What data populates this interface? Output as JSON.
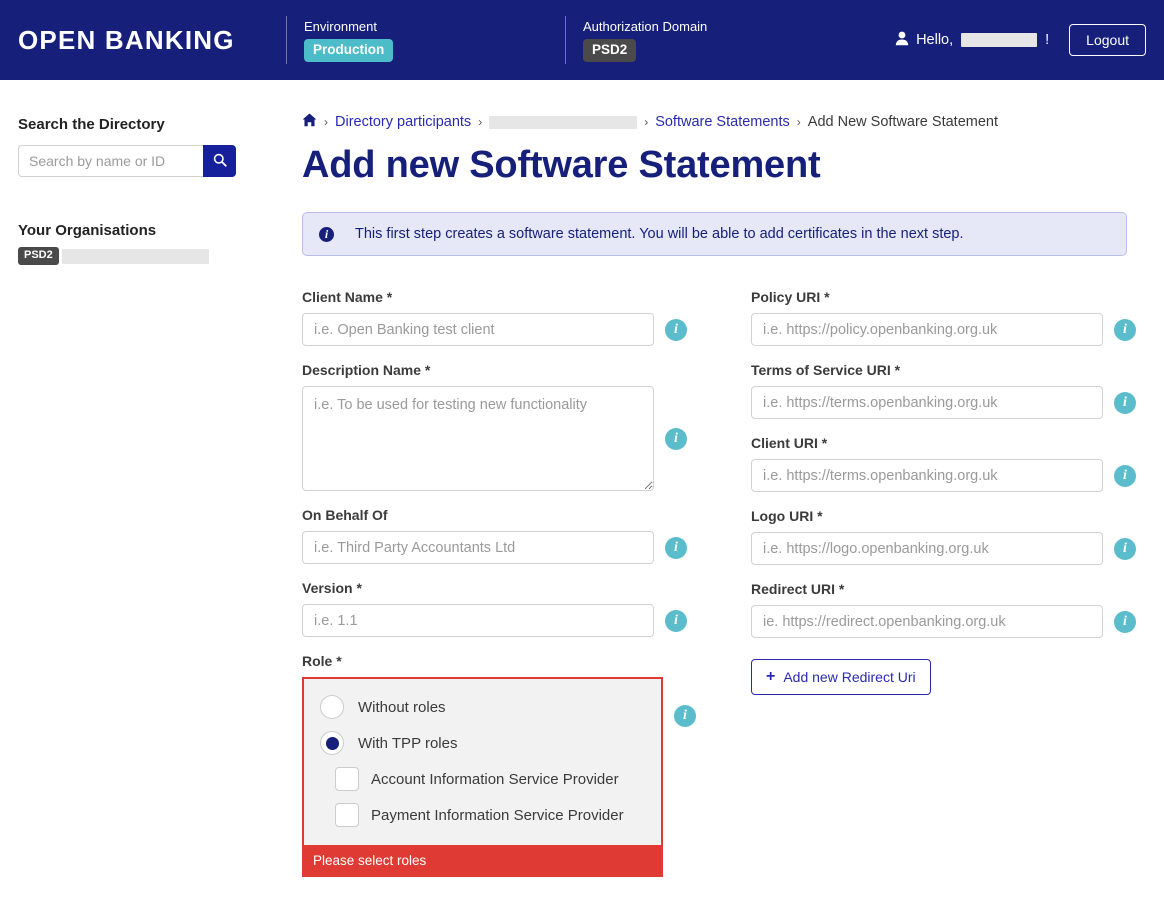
{
  "header": {
    "brand": "OPEN BANKING",
    "environment_label": "Environment",
    "environment_value": "Production",
    "authorization_domain_label": "Authorization Domain",
    "authorization_domain_value": "PSD2",
    "greeting_prefix": "Hello,",
    "greeting_suffix": "!",
    "logout_label": "Logout",
    "colors": {
      "bar_background": "#16207a",
      "environment_badge": "#4cbcc8",
      "domain_badge": "#4a4a4a"
    }
  },
  "sidebar": {
    "search_title": "Search the Directory",
    "search_placeholder": "Search by name or ID",
    "search_value": "",
    "search_icon": "search-icon",
    "organisations_title": "Your Organisations",
    "organisation_badge": "PSD2"
  },
  "breadcrumb": {
    "home_icon": "home-icon",
    "items": [
      {
        "label": "Directory participants",
        "link": true
      },
      {
        "label": "",
        "redacted": true
      },
      {
        "label": "Software Statements",
        "link": true
      },
      {
        "label": "Add New Software Statement",
        "link": false
      }
    ],
    "separator": "›"
  },
  "main": {
    "page_title": "Add new Software Statement",
    "info_banner": {
      "icon": "info-icon",
      "text": "This first step creates a software statement. You will be able to add certificates in the next step."
    },
    "info_icon_name": "info-icon",
    "required_marker": "*"
  },
  "form": {
    "left_column": [
      {
        "name": "client-name",
        "label": "Client Name *",
        "type": "text",
        "placeholder": "i.e. Open Banking test client",
        "value": ""
      },
      {
        "name": "description-name",
        "label": "Description Name *",
        "type": "textarea",
        "placeholder": "i.e. To be used for testing new functionality",
        "value": ""
      },
      {
        "name": "on-behalf-of",
        "label": "On Behalf Of",
        "type": "text",
        "placeholder": "i.e. Third Party Accountants Ltd",
        "value": ""
      },
      {
        "name": "version",
        "label": "Version *",
        "type": "text",
        "placeholder": "i.e. 1.1",
        "value": ""
      }
    ],
    "right_column": [
      {
        "name": "policy-uri",
        "label": "Policy URI *",
        "type": "text",
        "placeholder": "i.e. https://policy.openbanking.org.uk",
        "value": ""
      },
      {
        "name": "terms-of-service-uri",
        "label": "Terms of Service URI *",
        "type": "text",
        "placeholder": "i.e. https://terms.openbanking.org.uk",
        "value": ""
      },
      {
        "name": "client-uri",
        "label": "Client URI *",
        "type": "text",
        "placeholder": "i.e. https://terms.openbanking.org.uk",
        "value": ""
      },
      {
        "name": "logo-uri",
        "label": "Logo URI *",
        "type": "text",
        "placeholder": "i.e. https://logo.openbanking.org.uk",
        "value": ""
      },
      {
        "name": "redirect-uri",
        "label": "Redirect URI *",
        "type": "text",
        "placeholder": "ie. https://redirect.openbanking.org.uk",
        "value": ""
      }
    ],
    "add_redirect_button": "Add new Redirect Uri",
    "add_redirect_icon": "plus-icon",
    "role": {
      "label": "Role *",
      "options": [
        {
          "label": "Without roles",
          "selected": false
        },
        {
          "label": "With TPP roles",
          "selected": true
        }
      ],
      "sub_options": [
        {
          "label": "Account Information Service Provider",
          "checked": false
        },
        {
          "label": "Payment Information Service Provider",
          "checked": false
        }
      ],
      "error_message": "Please select roles",
      "error_color": "#e03a35"
    }
  }
}
